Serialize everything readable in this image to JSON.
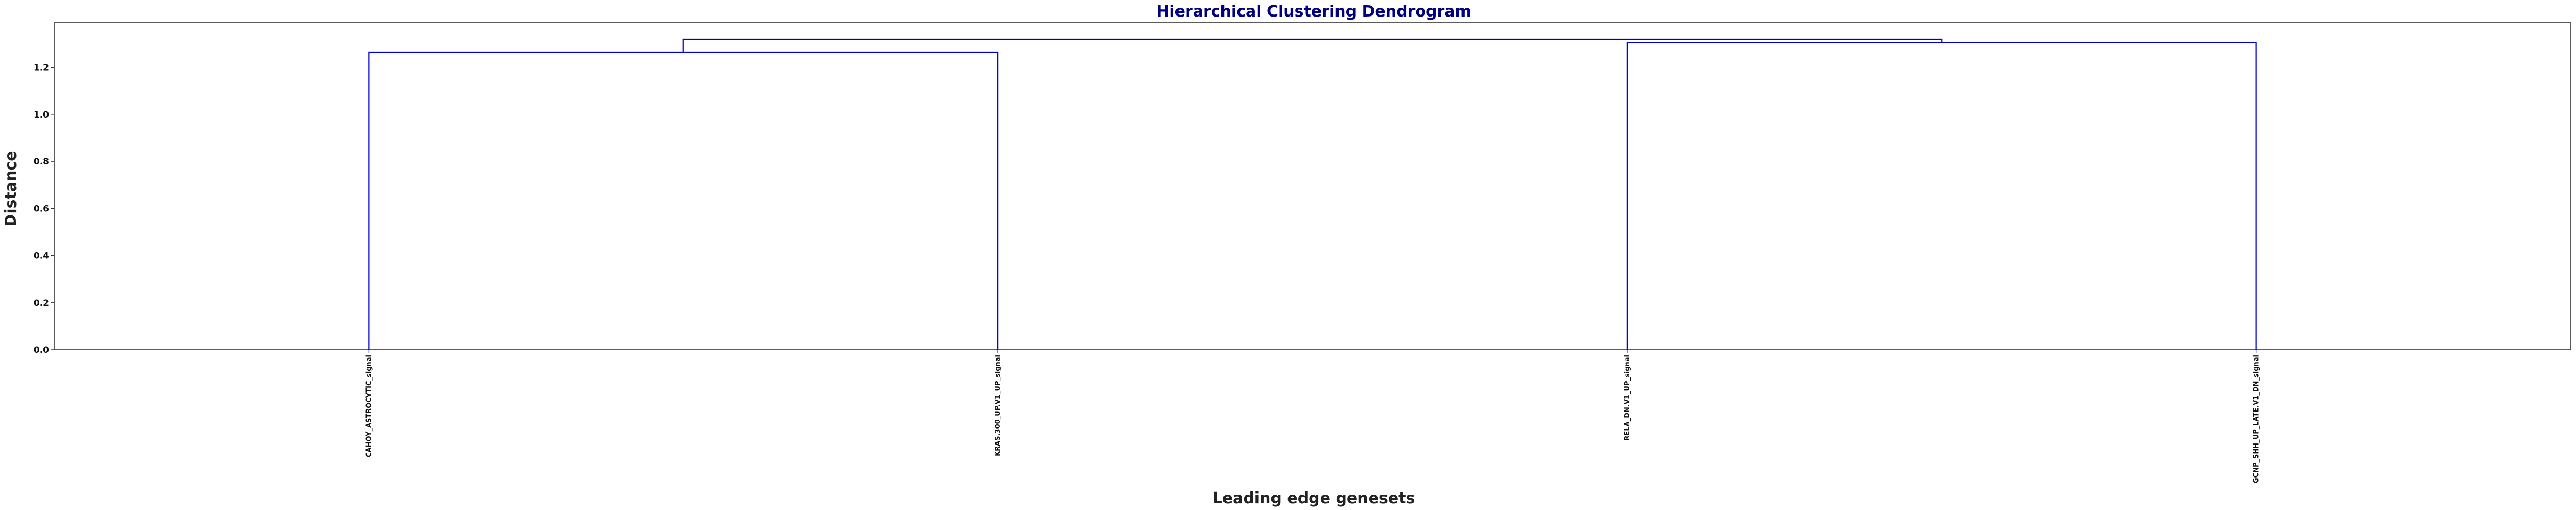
{
  "chart_data": {
    "type": "dendrogram",
    "title": "Hierarchical Clustering Dendrogram",
    "xlabel": "Leading edge genesets",
    "ylabel": "Distance",
    "ylim": [
      0,
      1.39
    ],
    "yticks": [
      "0.0",
      "0.2",
      "0.4",
      "0.6",
      "0.8",
      "1.0",
      "1.2"
    ],
    "leaves": [
      "CAHOY_ASTROCYTIC_signal",
      "KRAS.300_UP.V1_UP_signal",
      "RELA_DN.V1_UP_signal",
      "GCNP_SHH_UP_LATE.V1_DN_signal"
    ],
    "merges": [
      {
        "left": 0,
        "right": 1,
        "height": 1.265
      },
      {
        "left": 2,
        "right": 3,
        "height": 1.305
      },
      {
        "left": 4,
        "right": 5,
        "height": 1.32
      }
    ],
    "link_color": "#0000cc",
    "title_color": "#000080"
  }
}
